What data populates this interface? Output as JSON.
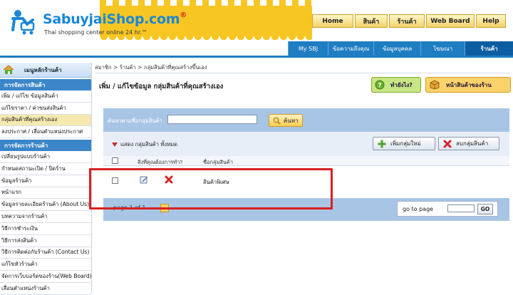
{
  "header": {
    "brand": "SabuyjaiShop.com",
    "brand_mark": "®",
    "tagline": "Thai shopping center online 24 hr.™",
    "accent_blue": "#1f7dc2",
    "awning_yellow": "#f7c623"
  },
  "main_nav": [
    {
      "label": "Home",
      "w": 56
    },
    {
      "label": "สินค้า",
      "w": 44
    },
    {
      "label": "ร้านค้า",
      "w": 48
    },
    {
      "label": "Web Board",
      "w": 66
    },
    {
      "label": "Help",
      "w": 40
    }
  ],
  "sub_nav": [
    {
      "label": "My SBJ",
      "w": 56
    },
    {
      "label": "ข้อความถึงคุณ",
      "w": 64
    },
    {
      "label": "ข้อมูลบุคคล",
      "w": 66
    },
    {
      "label": "โฆษณา",
      "w": 62
    },
    {
      "label": "ร้านค้า",
      "w": 68,
      "active": true
    }
  ],
  "sidebar": {
    "home_label": "เมนูหลักร้านค้า",
    "section1_title": "การจัดการสินค้า",
    "section1_items": [
      "เพิ่ม / แก้ไข ข้อมูลสินค้า",
      "แก้ไขราคา / ค่าขนส่งสินค้า",
      "กลุ่มสินค้าที่คุณสร้างเอง",
      "ลงประกาศ / เลื่อนตำแหน่งประกาศ"
    ],
    "active_index": 2,
    "section2_title": "การจัดการร้านค้า",
    "section2_items": [
      "เปลี่ยนรูปแบบร้านค้า",
      "กำหนดสถานะเปิด / ปิดร้าน",
      "ข้อมูลร้านค้า",
      "หน้าแรก",
      "ข้อมูลรายละเอียดร้านค้า (About Us)",
      "บทความจากร้านค้า",
      "วิธีการชำระเงิน",
      "วิธีการส่งสินค้า",
      "วิธีการติดต่อกับร้านค้า (Contact Us)",
      "แก้ไขหัวร้านค้า",
      "จัดการเว็บบอร์ดของร้าน(Web Board)",
      "เลื่อนตำแหน่งร้านค้า"
    ]
  },
  "content": {
    "breadcrumb": "สมาชิก > ร้านค้า > กลุ่มสินค้าที่คุณสร้างขึ้นเอง",
    "title": "เพิ่ม / แก้ไขข้อมูล กลุ่มสินค้าที่คุณสร้างเอง",
    "help_button": "ทำยังไง?",
    "store_button": "หน้าสินค้าของร้าน",
    "search_label": "ค้นหาตามชื่อกลุ่มสินค้า",
    "search_value": "",
    "search_button": "ค้นหา",
    "filter_label": "แสดง กลุ่มสินค้า ทั้งหมด",
    "add_button": "เพิ่มกลุ่มใหม่",
    "delete_button": "ลบกลุ่มสินค้า",
    "col_action": "สิ่งที่คุณต้องการทำ?",
    "col_name": "ชื่อกลุ่มสินค้า",
    "rows": [
      {
        "name": "สินค้าพิเศษ"
      }
    ],
    "page_label": "page 1 of 1",
    "goto_label": "go to page",
    "goto_value": "",
    "go_button": "GO"
  }
}
